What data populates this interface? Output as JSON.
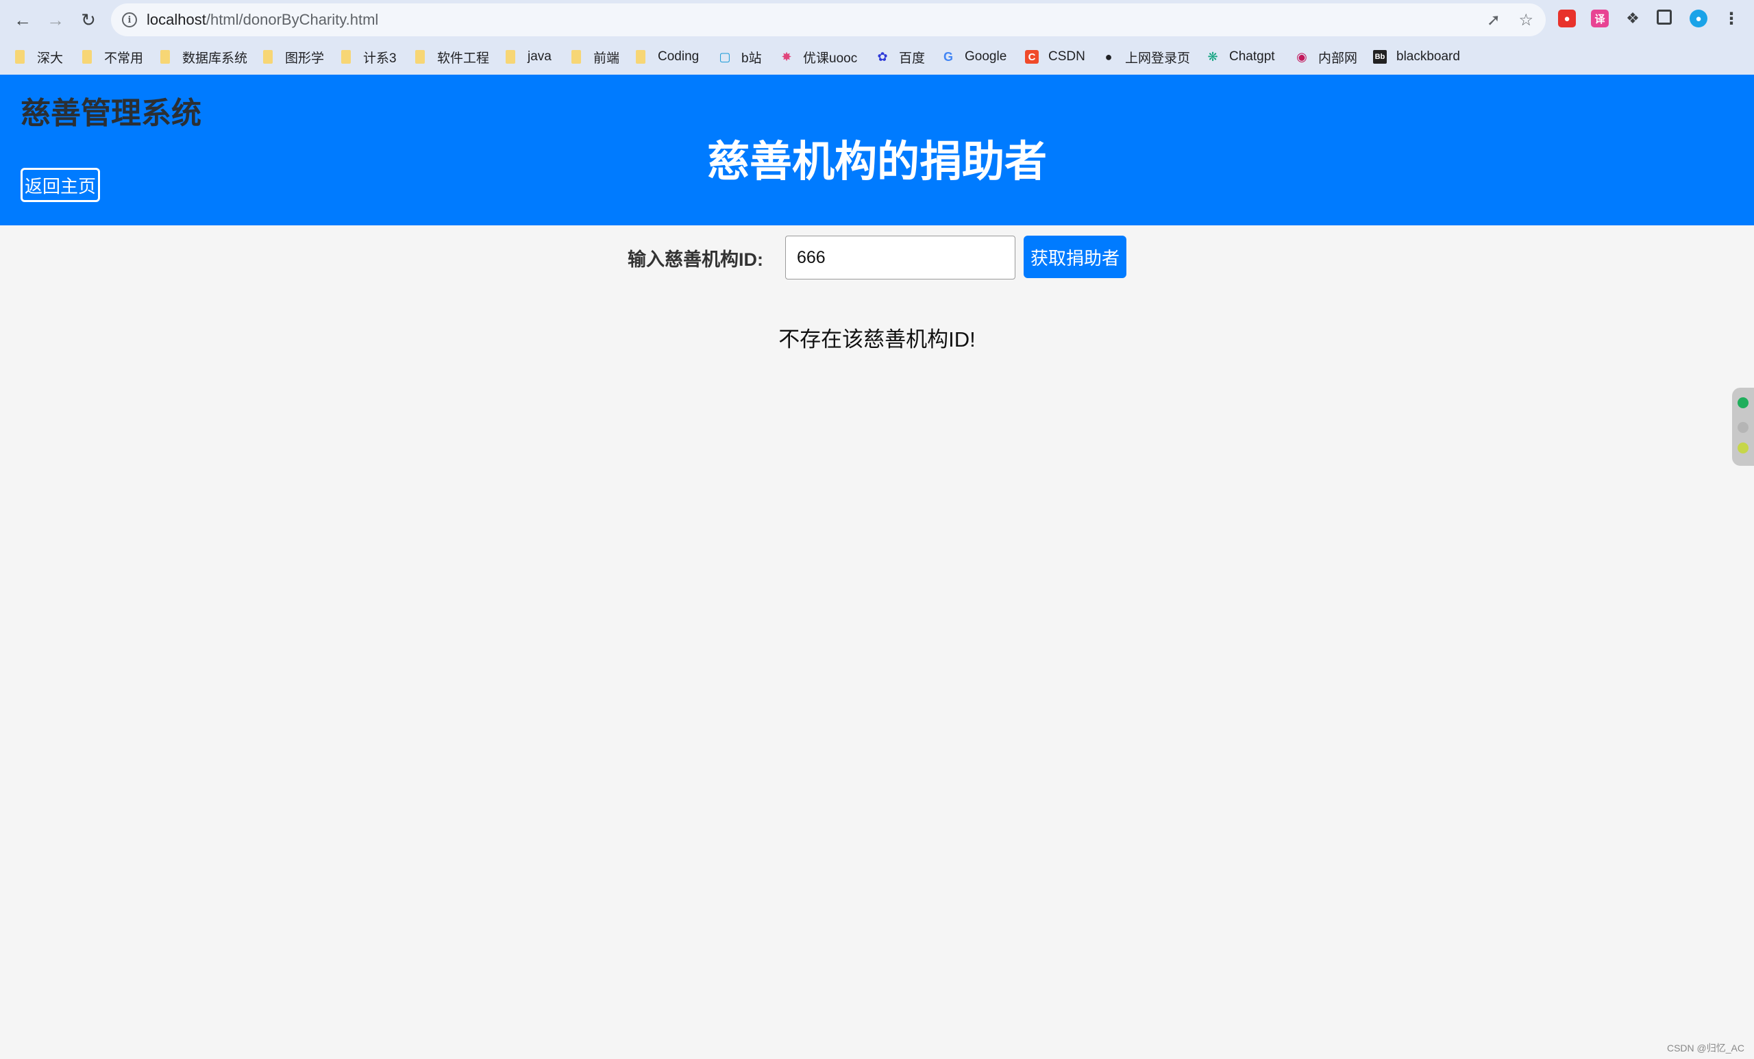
{
  "browser": {
    "url_host": "localhost",
    "url_path": "/html/donorByCharity.html",
    "bookmarks": [
      {
        "label": "深大",
        "icon": "folder-icon"
      },
      {
        "label": "不常用",
        "icon": "folder-icon"
      },
      {
        "label": "数据库系统",
        "icon": "folder-icon"
      },
      {
        "label": "图形学",
        "icon": "folder-icon"
      },
      {
        "label": "计系3",
        "icon": "folder-icon"
      },
      {
        "label": "软件工程",
        "icon": "folder-icon"
      },
      {
        "label": "java",
        "icon": "folder-icon"
      },
      {
        "label": "前端",
        "icon": "folder-icon"
      },
      {
        "label": "Coding",
        "icon": "folder-icon"
      },
      {
        "label": "b站",
        "icon": "bilibili-icon"
      },
      {
        "label": "优课uooc",
        "icon": "uooc-icon"
      },
      {
        "label": "百度",
        "icon": "baidu-icon"
      },
      {
        "label": "Google",
        "icon": "google-icon"
      },
      {
        "label": "CSDN",
        "icon": "csdn-icon"
      },
      {
        "label": "上网登录页",
        "icon": "globe-icon"
      },
      {
        "label": "Chatgpt",
        "icon": "chatgpt-icon"
      },
      {
        "label": "内部网",
        "icon": "intranet-icon"
      },
      {
        "label": "blackboard",
        "icon": "blackboard-icon"
      }
    ]
  },
  "header": {
    "system_title": "慈善管理系统",
    "home_button": "返回主页",
    "page_title": "慈善机构的捐助者"
  },
  "form": {
    "label": "输入慈善机构ID:",
    "input_value": "666",
    "submit_label": "获取捐助者"
  },
  "result": {
    "message": "不存在该慈善机构ID!"
  },
  "watermark": "CSDN @归忆_AC",
  "colors": {
    "header_bg": "#007bff",
    "button_bg": "#007bff",
    "page_bg": "#f5f5f5"
  }
}
